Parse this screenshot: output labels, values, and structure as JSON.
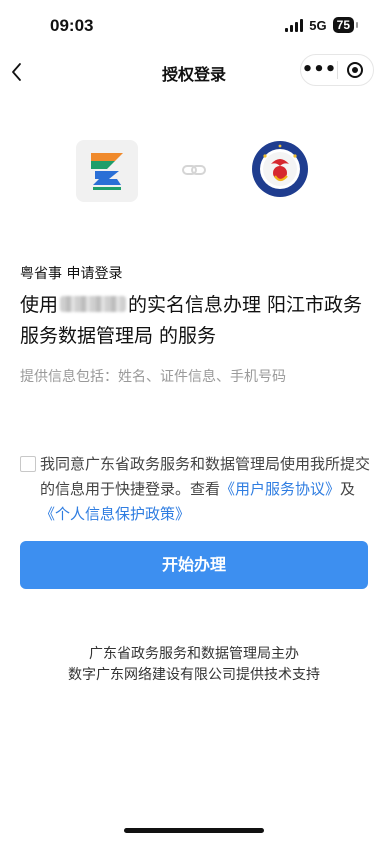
{
  "status_bar": {
    "time": "09:03",
    "network": "5G",
    "battery": "75"
  },
  "nav": {
    "back_icon": "back-chevron-icon",
    "title": "授权登录",
    "more_icon": "more-dots-icon",
    "close_icon": "miniprogram-close-icon"
  },
  "logos": {
    "app_logo_icon": "yueshengshi-logo-icon",
    "link_icon": "link-chain-icon",
    "org_logo_icon": "organization-emblem-icon"
  },
  "request": {
    "applicant": "粤省事 申请登录",
    "prefix": "使用",
    "suffix": "的实名信息办理 阳江市政务服务数据管理局 的服务",
    "info": "提供信息包括：姓名、证件信息、手机号码"
  },
  "agreement": {
    "text": "我同意广东省政务服务和数据管理局使用我所提交的信息用于快捷登录。查看",
    "link_user_service": "《用户服务协议》",
    "conj": "及",
    "link_privacy": "《个人信息保护政策》"
  },
  "actions": {
    "start_button": "开始办理"
  },
  "footer": {
    "line1": "广东省政务服务和数据管理局主办",
    "line2": "数字广东网络建设有限公司提供技术支持"
  },
  "colors": {
    "primary": "#3d8ff0",
    "link": "#2f7de1",
    "muted": "#9a9a9a"
  }
}
